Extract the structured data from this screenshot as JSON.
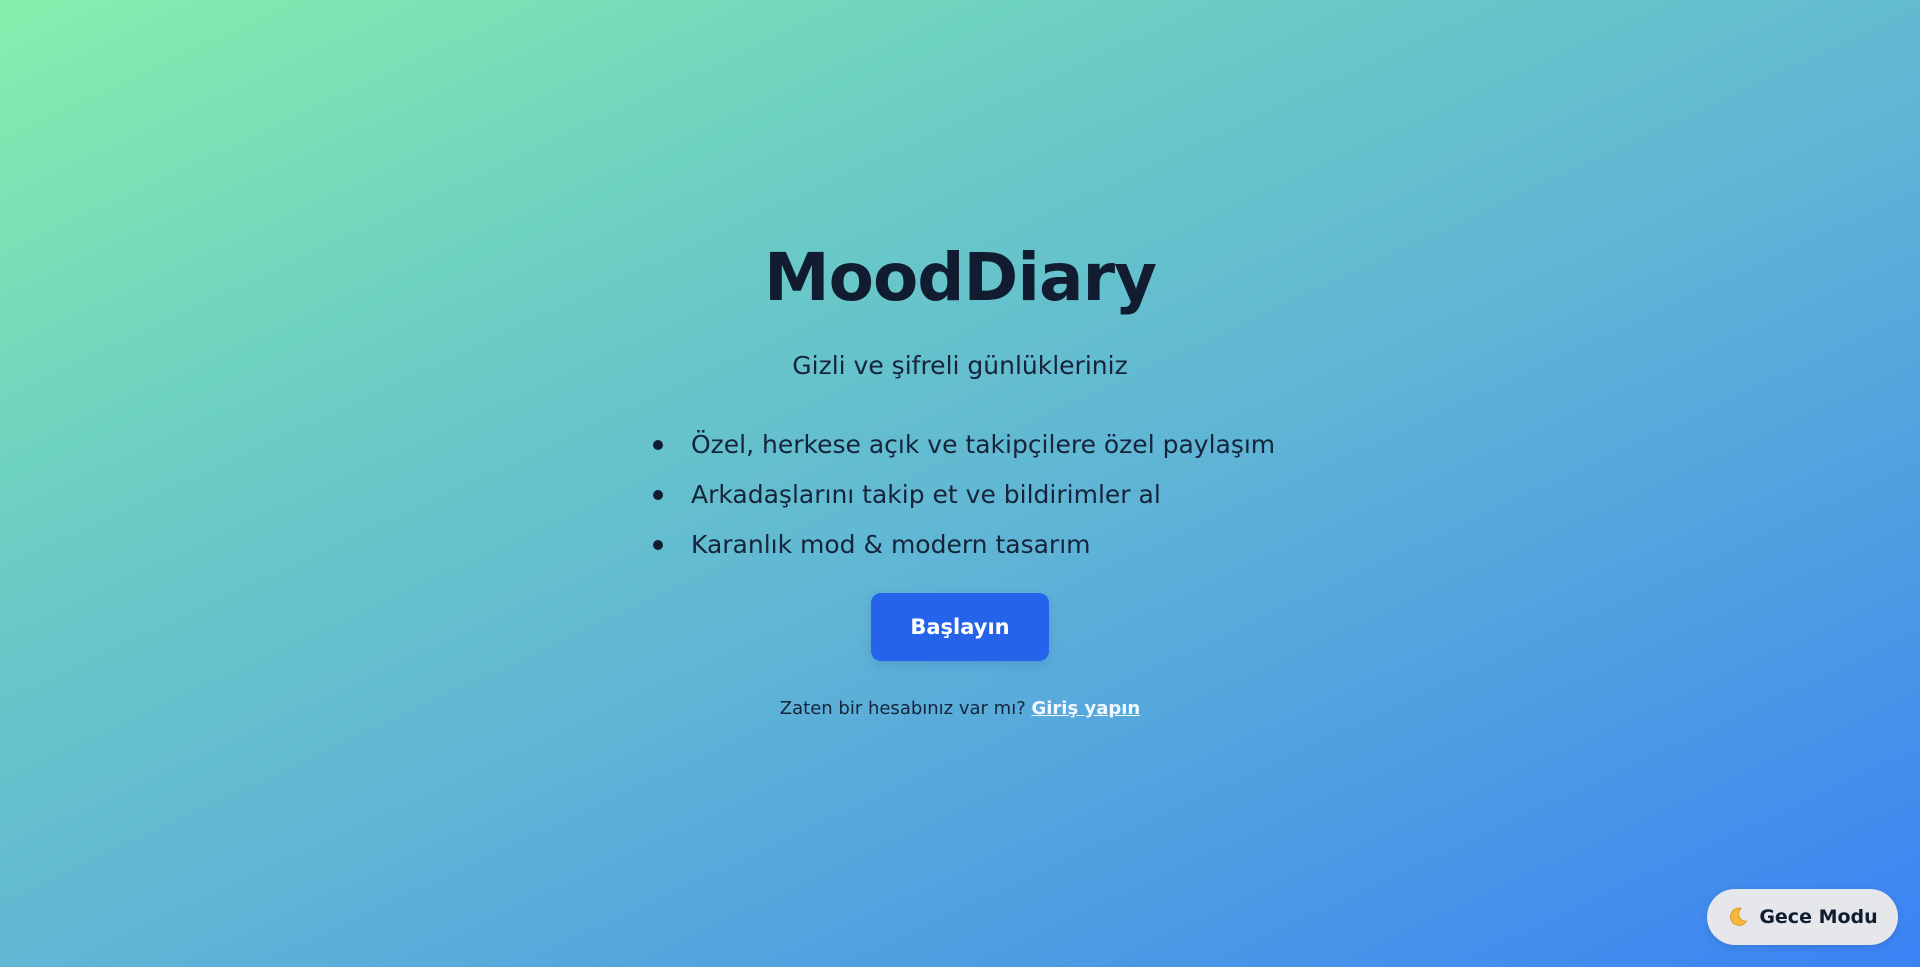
{
  "app": {
    "title": "MoodDiary",
    "subtitle": "Gizli ve şifreli günlükleriniz"
  },
  "features": [
    "Özel, herkese açık ve takipçilere özel paylaşım",
    "Arkadaşlarını takip et ve bildirimler al",
    "Karanlık mod & modern tasarım"
  ],
  "cta": {
    "label": "Başlayın"
  },
  "login": {
    "prompt": "Zaten bir hesabınız var mı?",
    "link_label": "Giriş yapın"
  },
  "theme_toggle": {
    "label": "Gece Modu",
    "icon": "moon-icon"
  },
  "colors": {
    "gradient_start": "#86efac",
    "gradient_end": "#3b82f6",
    "accent": "#2563eb",
    "text": "#111c30"
  }
}
